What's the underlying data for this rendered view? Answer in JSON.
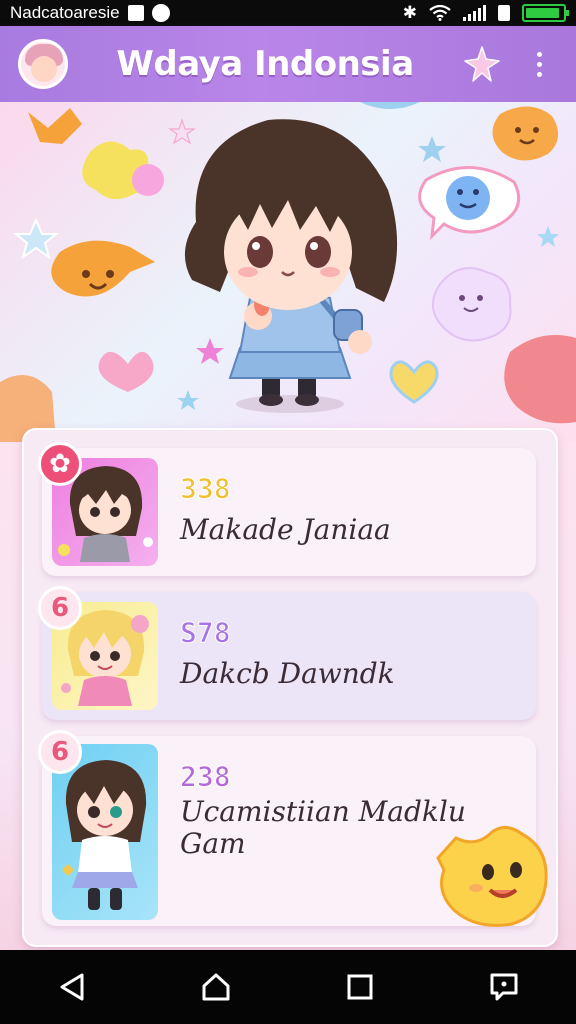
{
  "status_bar": {
    "carrier": "Nadcatoaresie",
    "battery_level": 0.82
  },
  "app_bar": {
    "title": "Wdaya Indonsia",
    "avatar_icon": "avatar-icon",
    "sparkle_icon": "sparkle-star-icon",
    "menu_icon": "more-vert-icon"
  },
  "colors": {
    "appbar": "#b082e4",
    "badge": "#ee4f78",
    "score_yellow": "#f0c030",
    "score_purple": "#a673e8",
    "score_violet": "#b36ad8"
  },
  "leaderboard": [
    {
      "badge": "✿",
      "score": "338",
      "name": "Makade Janiaa",
      "card_color": "#fbf1f8",
      "score_color": "#f0c030"
    },
    {
      "badge": "6",
      "score": "S78",
      "name": "Dakcb Dawndk",
      "card_color": "#ece4f7",
      "score_color": "#a673e8"
    },
    {
      "badge": "6",
      "score": "238",
      "name": "Ucamistiian Madklu Gam",
      "card_color": "#fbf1f8",
      "score_color": "#b36ad8"
    }
  ],
  "nav": {
    "back_icon": "back-triangle-icon",
    "home_icon": "home-icon",
    "recents_icon": "recents-square-icon",
    "feedback_icon": "feedback-icon"
  }
}
